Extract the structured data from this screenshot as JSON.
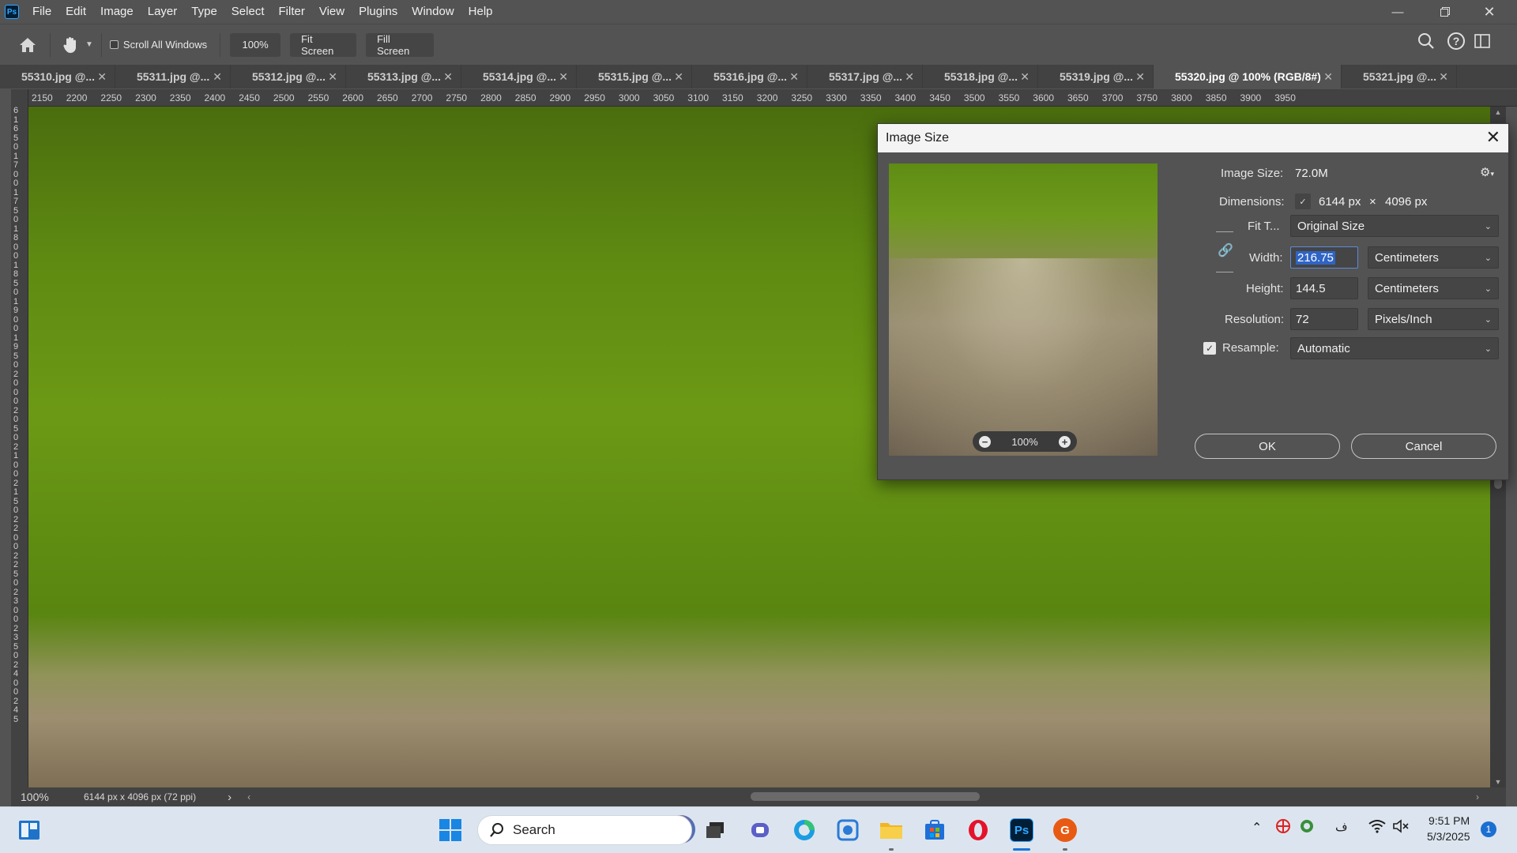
{
  "app": {
    "logo": "Ps",
    "menu": [
      "File",
      "Edit",
      "Image",
      "Layer",
      "Type",
      "Select",
      "Filter",
      "View",
      "Plugins",
      "Window",
      "Help"
    ],
    "window_controls": [
      "minimize",
      "restore",
      "close"
    ]
  },
  "options_bar": {
    "scroll_all_windows": "Scroll All Windows",
    "scroll_all_checked": false,
    "zoom_value": "100%",
    "fit_screen": "Fit Screen",
    "fill_screen": "Fill Screen"
  },
  "tabs": [
    {
      "label": "55310.jpg @...",
      "active": false
    },
    {
      "label": "55311.jpg @...",
      "active": false
    },
    {
      "label": "55312.jpg @...",
      "active": false
    },
    {
      "label": "55313.jpg @...",
      "active": false
    },
    {
      "label": "55314.jpg @...",
      "active": false
    },
    {
      "label": "55315.jpg @...",
      "active": false
    },
    {
      "label": "55316.jpg @...",
      "active": false
    },
    {
      "label": "55317.jpg @...",
      "active": false
    },
    {
      "label": "55318.jpg @...",
      "active": false
    },
    {
      "label": "55319.jpg @...",
      "active": false
    },
    {
      "label": "55320.jpg @ 100% (RGB/8#)",
      "active": true
    },
    {
      "label": "55321.jpg @...",
      "active": false
    }
  ],
  "canvas": {
    "ruler_numbers": [
      "2150",
      "2200",
      "2250",
      "2300",
      "2350",
      "2400",
      "2450",
      "2500",
      "2550",
      "2600",
      "2650",
      "2700",
      "2750",
      "2800",
      "2850",
      "2900",
      "2950",
      "3000",
      "3050",
      "3100",
      "3150",
      "3200",
      "3250",
      "3300",
      "3350",
      "3400",
      "3450",
      "3500",
      "3550",
      "3600",
      "3650",
      "3700",
      "3750",
      "3800",
      "3850",
      "3900",
      "3950"
    ],
    "vertical_ruler_text": "6 1 6 5 0 1 7 0 0 1 7 5 0 1 8 0 0 1 8 5 0 1 9 0 0 1 9 5 0 2 0 0 0 2 0 5 0 2 1 0 0 2 1 5 0 2 2 0 0 2 2 5 0 2 3 0 0 2 3 5 0 2 4 0 0 2 4 5"
  },
  "status_bar": {
    "zoom": "100%",
    "doc_info": "6144 px x 4096 px (72 ppi)",
    "arrow": "›"
  },
  "dialog": {
    "title": "Image Size",
    "close": "✕",
    "image_size_label": "Image Size:",
    "image_size_value": "72.0M",
    "dimensions_label": "Dimensions:",
    "dim_width": "6144 px",
    "dim_sep": "×",
    "dim_height": "4096 px",
    "fit_label": "Fit T...",
    "fit_value": "Original Size",
    "width_label": "Width:",
    "width_value": "216.75",
    "width_unit": "Centimeters",
    "height_label": "Height:",
    "height_value": "144.5",
    "height_unit": "Centimeters",
    "resolution_label": "Resolution:",
    "resolution_value": "72",
    "resolution_unit": "Pixels/Inch",
    "resample_label": "Resample:",
    "resample_checked": true,
    "resample_value": "Automatic",
    "preview_zoom": "100%",
    "ok": "OK",
    "cancel": "Cancel"
  },
  "taskbar": {
    "search_placeholder": "Search",
    "time": "9:51 PM",
    "date": "5/3/2025",
    "notification_count": "1",
    "apps": [
      "start-icon",
      "file-explorer-icon",
      "task-view-icon",
      "teams-icon",
      "edge-icon",
      "camera-icon",
      "folder-icon",
      "store-icon",
      "opera-icon",
      "photoshop-icon",
      "grammarly-icon"
    ],
    "photoshop_label": "Ps",
    "grammarly_label": "G",
    "lang_indicator": "ف"
  }
}
